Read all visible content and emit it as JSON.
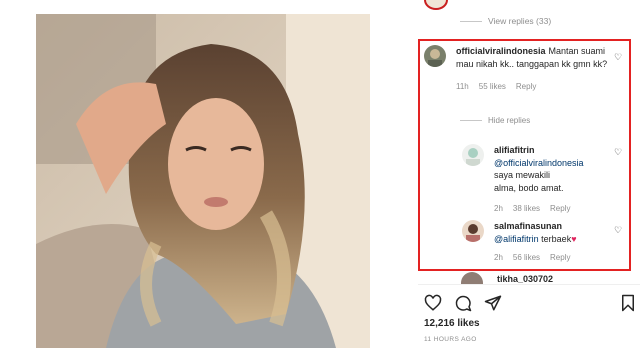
{
  "header": {
    "view_replies": "View replies (33)"
  },
  "comments": [
    {
      "username": "officialviralindonesia",
      "text": "Mantan suami mau nikah kk.. tanggapan kk gmn kk?",
      "time": "11h",
      "likes": "55 likes",
      "reply": "Reply"
    },
    {
      "username": "alifiafitrin",
      "mention": "@officialviralindonesia",
      "text": "saya mewakili alma, bodo amat.",
      "time": "2h",
      "likes": "38 likes",
      "reply": "Reply"
    },
    {
      "username": "salmafinasunan",
      "mention": "@alifiafitrin",
      "text": "terbaek",
      "time": "2h",
      "likes": "56 likes",
      "reply": "Reply"
    }
  ],
  "hide_replies": "Hide replies",
  "next_comment_user": "tikha_030702",
  "footer": {
    "likes": "12,216 likes",
    "time_ago": "11 HOURS AGO"
  },
  "colors": {
    "highlight": "#e32222",
    "mention": "#00376b",
    "muted": "#8e8e8e"
  },
  "icons": [
    "heart-icon",
    "comment-icon",
    "share-icon",
    "bookmark-icon"
  ]
}
